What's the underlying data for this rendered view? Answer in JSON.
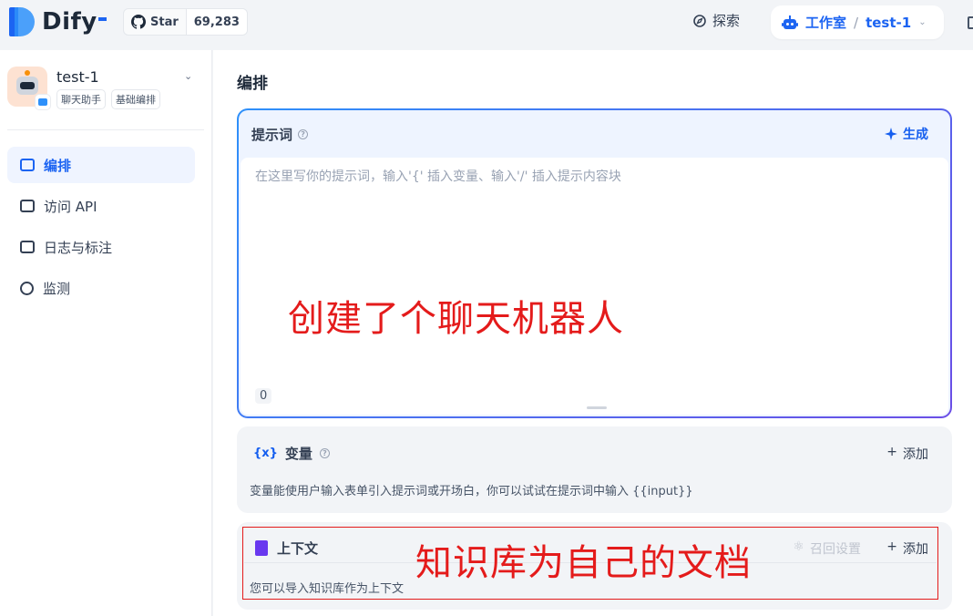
{
  "header": {
    "logo_text": "Dify",
    "github_label": "Star",
    "github_count": "69,283",
    "explore_label": "探索",
    "workspace_label": "工作室",
    "workspace_sep": "/",
    "workspace_app": "test-1",
    "accent_color": "#1c64f2"
  },
  "sidebar": {
    "app_name": "test-1",
    "tags": [
      "聊天助手",
      "基础编排"
    ],
    "items": [
      {
        "label": "编排",
        "icon": "layout-icon",
        "active": true
      },
      {
        "label": "访问 API",
        "icon": "terminal-icon",
        "active": false
      },
      {
        "label": "日志与标注",
        "icon": "file-list-icon",
        "active": false
      },
      {
        "label": "监测",
        "icon": "gauge-icon",
        "active": false
      }
    ]
  },
  "main": {
    "title": "编排",
    "prompt": {
      "label": "提示词",
      "generate_label": "生成",
      "placeholder": "在这里写你的提示词，输入'{' 插入变量、输入'/' 插入提示内容块",
      "char_count": "0"
    },
    "variables": {
      "label": "变量",
      "icon_text": "{x}",
      "add_label": "添加",
      "description": "变量能使用户输入表单引入提示词或开场白，你可以试试在提示词中输入 {{input}}"
    },
    "context": {
      "label": "上下文",
      "recall_label": "召回设置",
      "add_label": "添加",
      "description": "您可以导入知识库作为上下文"
    }
  },
  "annotations": {
    "note1": "创建了个聊天机器人",
    "note2": "知识库为自己的文档",
    "color": "#e41b1b"
  }
}
